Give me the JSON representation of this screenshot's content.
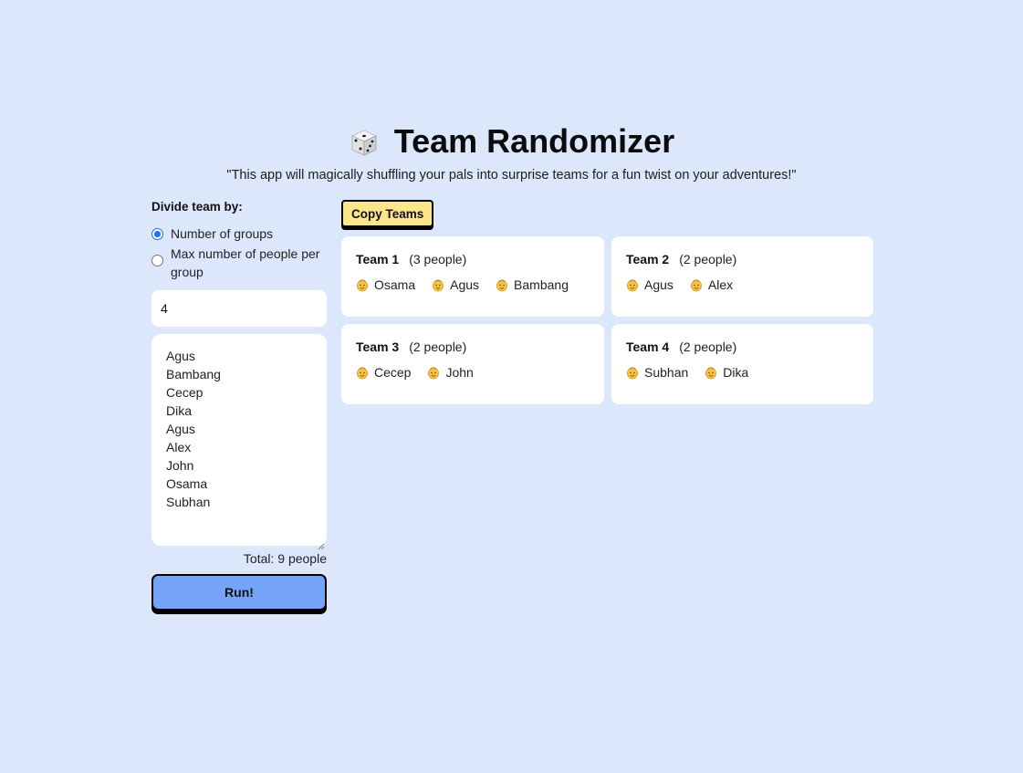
{
  "header": {
    "icon": "dice-icon",
    "title": "Team Randomizer",
    "subtitle": "\"This app will magically shuffling your pals into surprise teams for a fun twist on your adventures!\""
  },
  "settings": {
    "divide_label": "Divide team by:",
    "options": [
      {
        "label": "Number of groups",
        "checked": true
      },
      {
        "label": "Max number of people per group",
        "checked": false
      }
    ],
    "group_count": "4",
    "names": [
      "Agus",
      "Bambang",
      "Cecep",
      "Dika",
      "Agus",
      "Alex",
      "John",
      "Osama",
      "Subhan"
    ],
    "total_text": "Total: 9 people",
    "run_label": "Run!"
  },
  "actions": {
    "copy_label": "Copy Teams"
  },
  "teams": [
    {
      "name": "Team 1",
      "count": "(3 people)",
      "members": [
        "Osama",
        "Agus",
        "Bambang"
      ]
    },
    {
      "name": "Team 2",
      "count": "(2 people)",
      "members": [
        "Agus",
        "Alex"
      ]
    },
    {
      "name": "Team 3",
      "count": "(2 people)",
      "members": [
        "Cecep",
        "John"
      ]
    },
    {
      "name": "Team 4",
      "count": "(2 people)",
      "members": [
        "Subhan",
        "Dika"
      ]
    }
  ],
  "icons": {
    "member": "person-icon"
  },
  "colors": {
    "background": "#dce7fc",
    "run_button": "#74a3f7",
    "copy_button": "#fde68a",
    "radio_accent": "#1a73e8"
  }
}
